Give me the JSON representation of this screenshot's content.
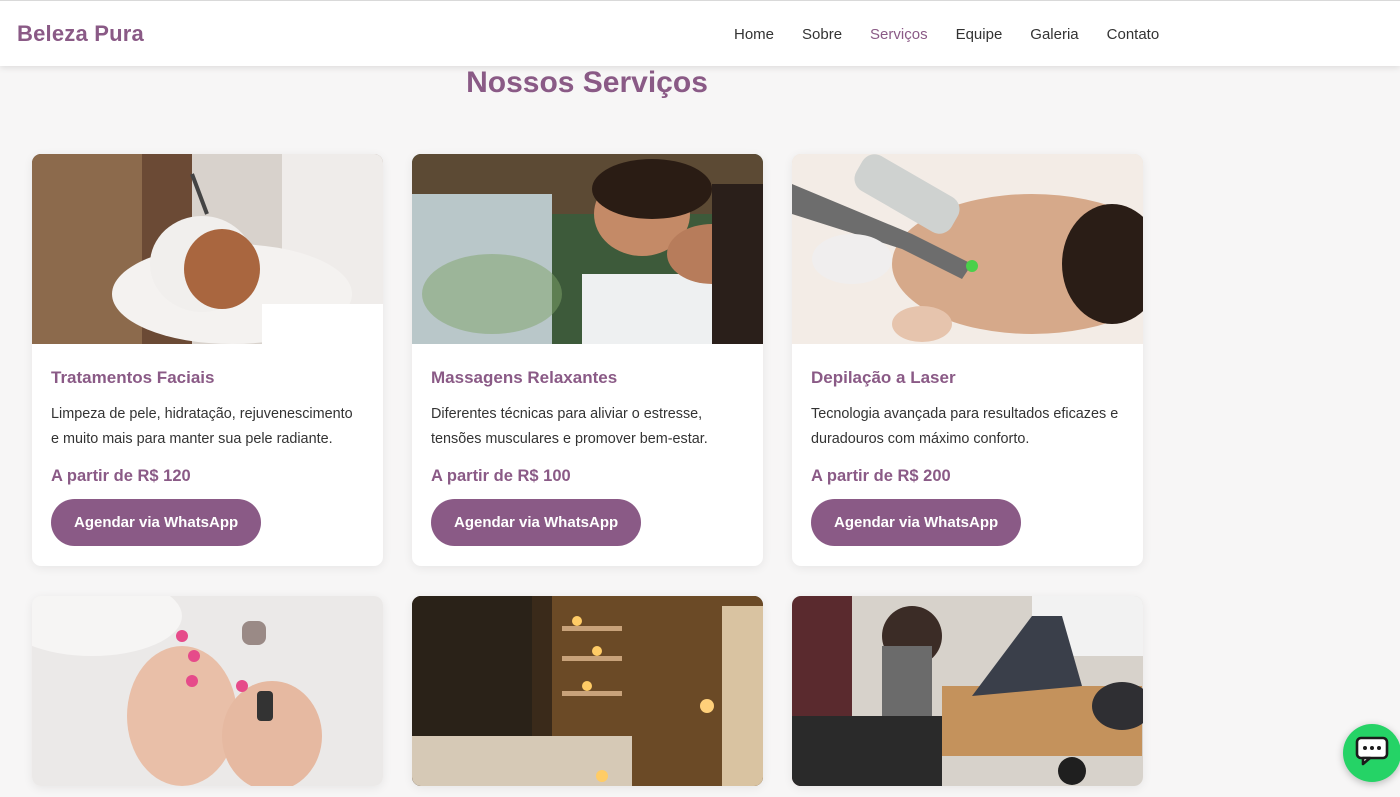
{
  "header": {
    "logo": "Beleza Pura",
    "nav": [
      {
        "label": "Home",
        "active": false
      },
      {
        "label": "Sobre",
        "active": false
      },
      {
        "label": "Serviços",
        "active": true
      },
      {
        "label": "Equipe",
        "active": false
      },
      {
        "label": "Galeria",
        "active": false
      },
      {
        "label": "Contato",
        "active": false
      }
    ]
  },
  "section": {
    "title": "Nossos Serviços"
  },
  "services": [
    {
      "title": "Tratamentos Faciais",
      "description": "Limpeza de pele, hidratação, rejuvenescimento e muito mais para manter sua pele radiante.",
      "price": "A partir de R$ 120",
      "button": "Agendar via WhatsApp",
      "image": "facial-treatment-photo"
    },
    {
      "title": "Massagens Relaxantes",
      "description": "Diferentes técnicas para aliviar o estresse, tensões musculares e promover bem-estar.",
      "price": "A partir de R$ 100",
      "button": "Agendar via WhatsApp",
      "image": "relaxing-massage-photo"
    },
    {
      "title": "Depilação a Laser",
      "description": "Tecnologia avançada para resultados eficazes e duradouros com máximo conforto.",
      "price": "A partir de R$ 200",
      "button": "Agendar via WhatsApp",
      "image": "laser-hair-removal-photo"
    },
    {
      "image": "manicure-photo"
    },
    {
      "image": "spa-candles-photo"
    },
    {
      "image": "pilates-photo"
    }
  ],
  "colors": {
    "brand": "#8a5a86",
    "whatsapp": "#25d366",
    "background": "#f7f6f6"
  },
  "floating_button": {
    "icon": "chat-icon"
  }
}
